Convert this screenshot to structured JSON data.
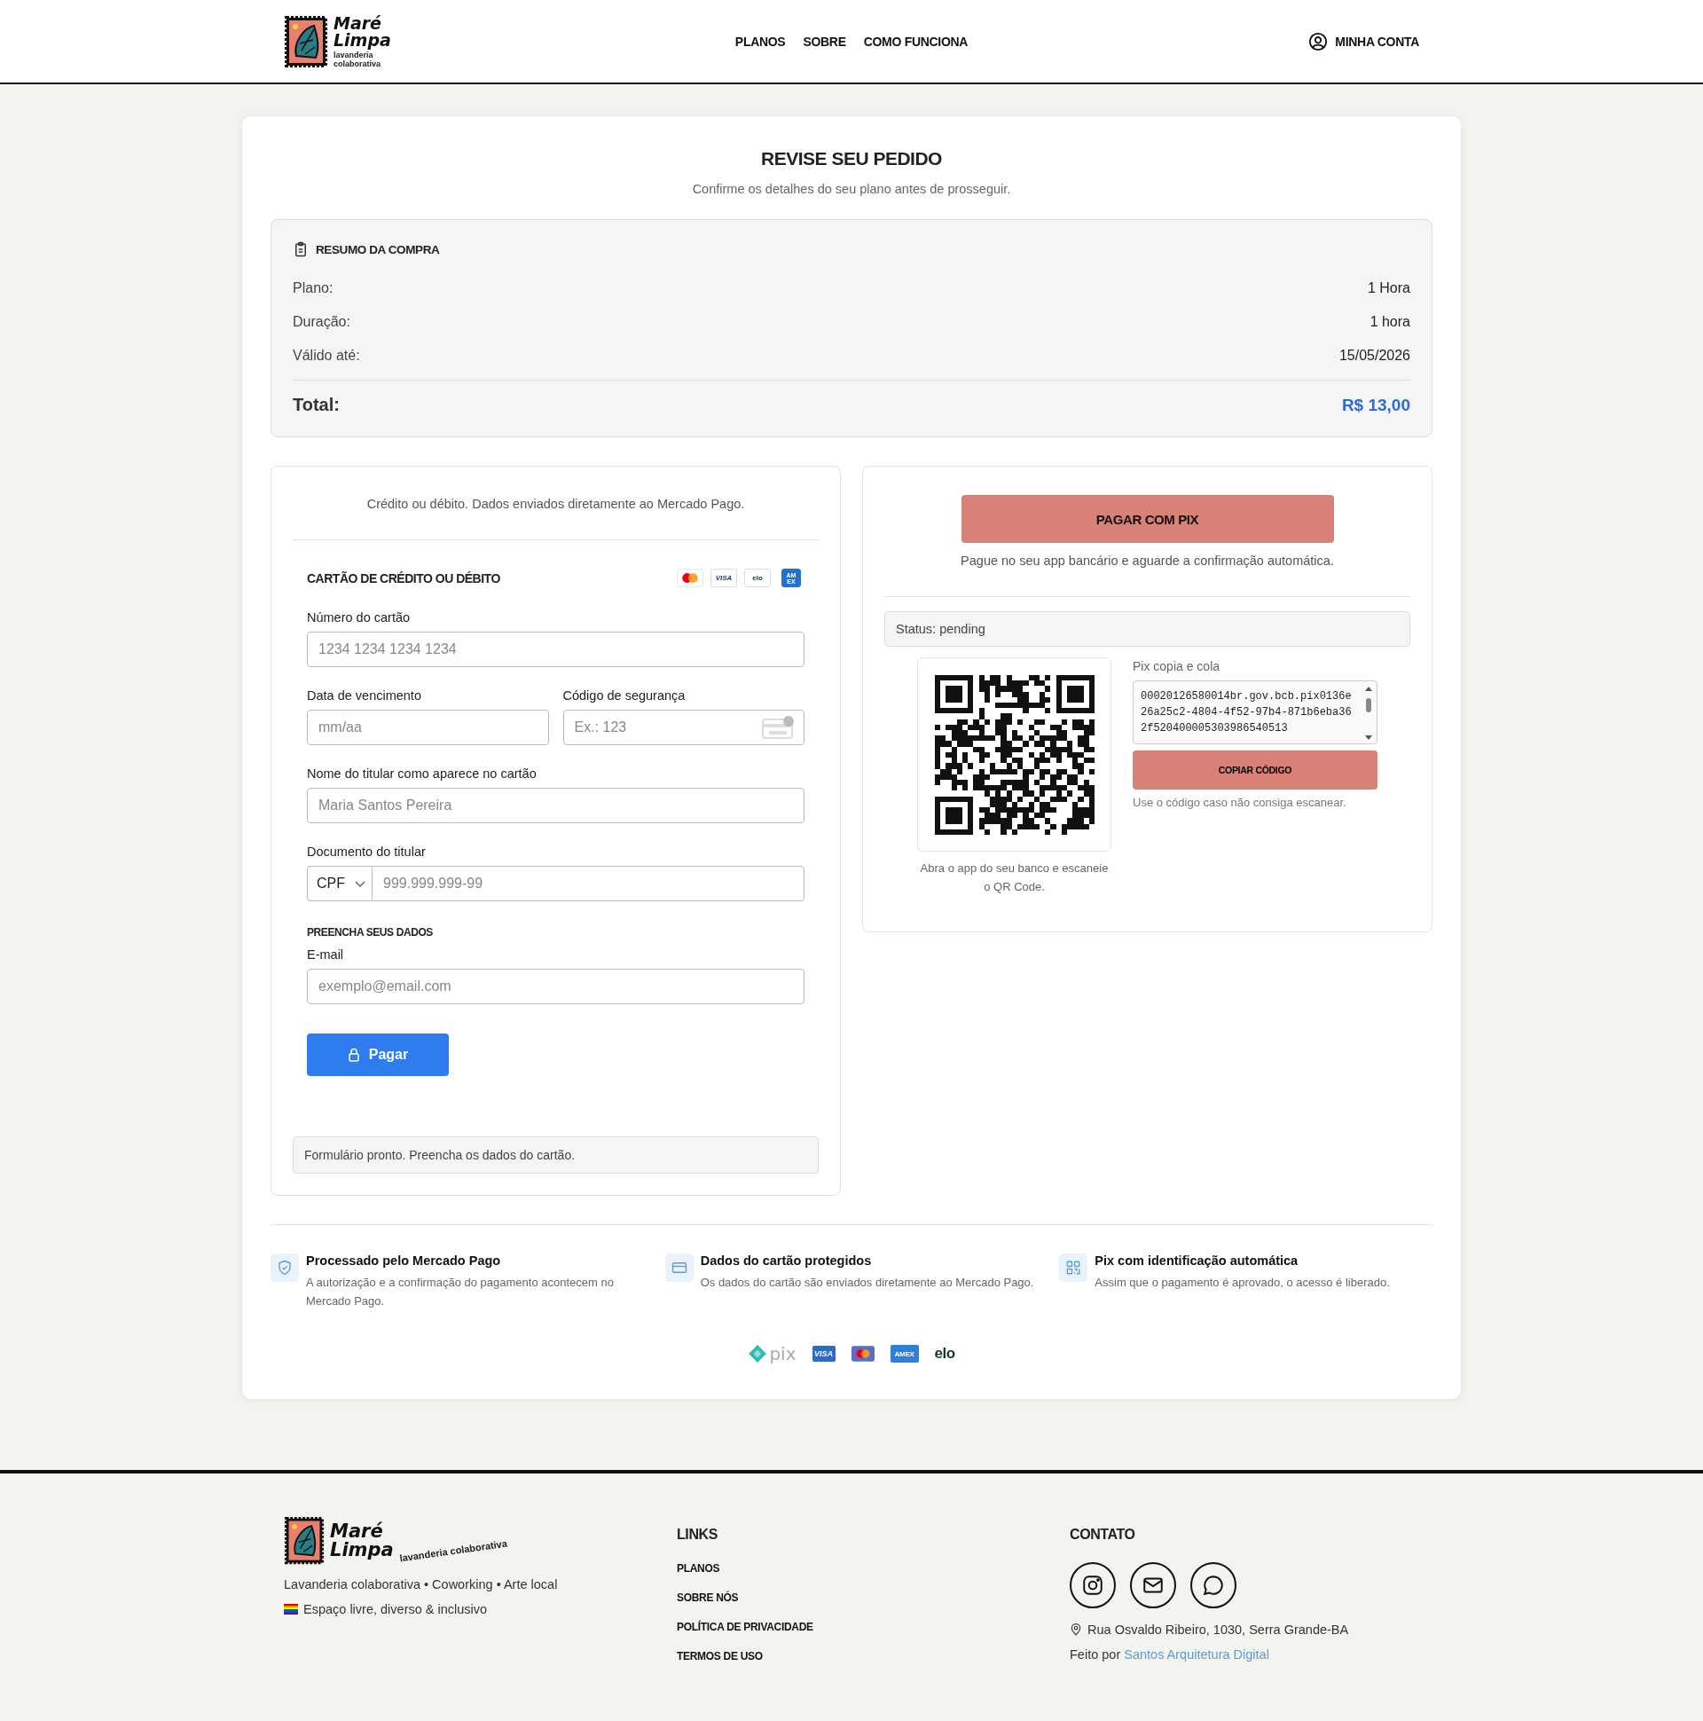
{
  "header": {
    "brand": {
      "name_line_1": "Maré",
      "name_line_2": "Limpa",
      "tagline_line_1": "lavanderia",
      "tagline_line_2": "colaborativa"
    },
    "nav": [
      "PLANOS",
      "SOBRE",
      "COMO FUNCIONA"
    ],
    "account": "MINHA CONTA"
  },
  "page": {
    "title": "REVISE SEU PEDIDO",
    "subtitle": "Confirme os detalhes do seu plano antes de prosseguir."
  },
  "summary": {
    "heading": "RESUMO DA COMPRA",
    "rows": [
      {
        "label": "Plano:",
        "value": "1 Hora"
      },
      {
        "label": "Duração:",
        "value": "1 hora"
      },
      {
        "label": "Válido até:",
        "value": "15/05/2026"
      }
    ],
    "total_label": "Total:",
    "total_value": "R$ 13,00"
  },
  "card_payment": {
    "intro": "Crédito ou débito. Dados enviados diretamente ao Mercado Pago.",
    "heading": "CARTÃO DE CRÉDITO OU DÉBITO",
    "brands": [
      {
        "kind": "mastercard"
      },
      {
        "kind": "visa",
        "label": "VISA"
      },
      {
        "kind": "elo",
        "label": "elo"
      },
      {
        "kind": "amex",
        "label": "AM EX"
      }
    ],
    "card_number": {
      "label": "Número do cartão",
      "placeholder": "1234 1234 1234 1234"
    },
    "expiry": {
      "label": "Data de vencimento",
      "placeholder": "mm/aa"
    },
    "cvv": {
      "label": "Código de segurança",
      "placeholder": "Ex.: 123"
    },
    "holder": {
      "label": "Nome do titular como aparece no cartão",
      "placeholder": "Maria Santos Pereira"
    },
    "document": {
      "label": "Documento do titular",
      "type": "CPF",
      "placeholder": "999.999.999-99"
    },
    "section_heading": "PREENCHA SEUS DADOS",
    "email": {
      "label": "E-mail",
      "placeholder": "exemplo@email.com"
    },
    "pay_button": "Pagar",
    "status": "Formulário pronto. Preencha os dados do cartão."
  },
  "pix_payment": {
    "button": "PAGAR COM PIX",
    "caption": "Pague no seu app bancário e aguarde a confirmação automática.",
    "status": "Status: pending",
    "qr_caption": "Abra o app do seu banco e escaneie o QR Code.",
    "code_label": "Pix copia e cola",
    "code": "00020126580014br.gov.bcb.pix0136e26a25c2-4804-4f52-97b4-871b6eba362f520400005303986540513",
    "copy_button": "COPIAR CÓDIGO",
    "copy_hint": "Use o código caso não consiga escanear."
  },
  "features": [
    {
      "kind": "shield",
      "title": "Processado pelo Mercado Pago",
      "text": "A autorização e a confirmação do pagamento acontecem no Mercado Pago."
    },
    {
      "kind": "card",
      "title": "Dados do cartão protegidos",
      "text": "Os dados do cartão são enviados diretamente ao Mercado Pago."
    },
    {
      "kind": "qr",
      "title": "Pix com identificação automática",
      "text": "Assim que o pagamento é aprovado, o acesso é liberado."
    }
  ],
  "payment_logos": [
    {
      "kind": "pix",
      "label": "pix"
    },
    {
      "kind": "visa",
      "label": "VISA"
    },
    {
      "kind": "mastercard"
    },
    {
      "kind": "amex",
      "label": "AMEX"
    },
    {
      "kind": "elo",
      "label": "elo"
    }
  ],
  "footer": {
    "brand": {
      "name_line_1": "Maré",
      "name_line_2": "Limpa",
      "tagline": "lavanderia colaborativa"
    },
    "about": "Lavanderia colaborativa • Coworking • Arte local",
    "motto": "Espaço livre, diverso & inclusivo",
    "links_heading": "LINKS",
    "links": [
      "PLANOS",
      "SOBRE NÓS",
      "POLÍTICA DE PRIVACIDADE",
      "TERMOS DE USO"
    ],
    "contact_heading": "CONTATO",
    "social": [
      {
        "kind": "instagram"
      },
      {
        "kind": "email"
      },
      {
        "kind": "whatsapp"
      }
    ],
    "address": "Rua Osvaldo Ribeiro, 1030, Serra Grande-BA",
    "credit_prefix": "Feito por",
    "credit_link": "Santos Arquitetura Digital"
  }
}
